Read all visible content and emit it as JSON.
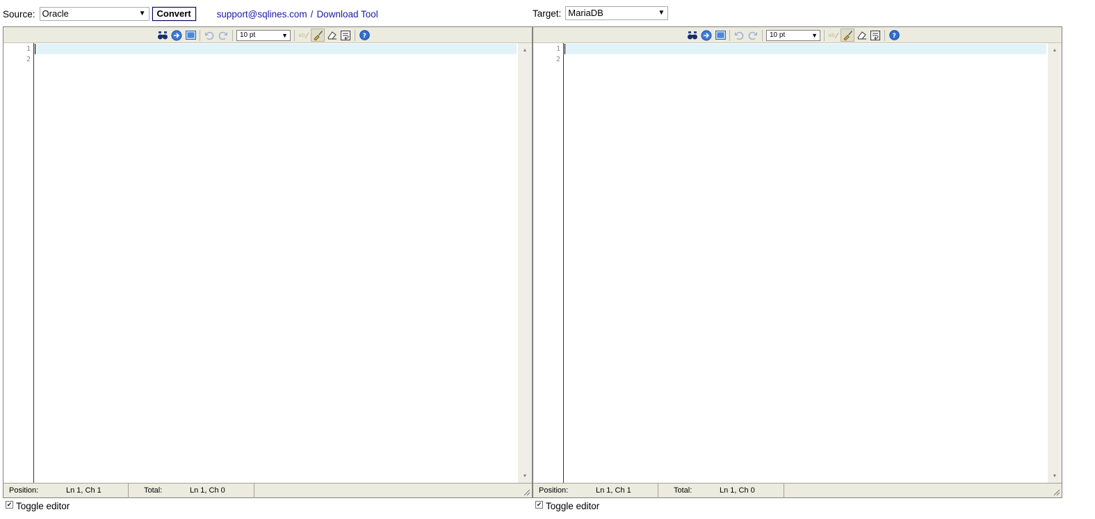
{
  "source": {
    "label": "Source:",
    "selected": "Oracle",
    "convert_label": "Convert",
    "support_link": "support@sqlines.com",
    "separator": "/",
    "download_link": "Download Tool"
  },
  "target": {
    "label": "Target:",
    "selected": "MariaDB"
  },
  "editors": {
    "left": {
      "font_size": "10 pt",
      "line_numbers": [
        "1",
        "2"
      ],
      "status": {
        "position_label": "Position:",
        "position_value": "Ln 1, Ch 1",
        "total_label": "Total:",
        "total_value": "Ln 1, Ch 0"
      },
      "toggle_label": "Toggle editor",
      "toggle_checked": "✔"
    },
    "right": {
      "font_size": "10 pt",
      "line_numbers": [
        "1",
        "2"
      ],
      "status": {
        "position_label": "Position:",
        "position_value": "Ln 1, Ch 1",
        "total_label": "Total:",
        "total_value": "Ln 1, Ch 0"
      },
      "toggle_label": "Toggle editor",
      "toggle_checked": "✔"
    }
  },
  "icons": {
    "arrow": "▼",
    "scroll_up": "▲",
    "scroll_down": "▼"
  },
  "colors": {
    "toolbar_bg": "#ecebdf",
    "active_line": "#e1f3f9",
    "link": "#1a1aa6"
  }
}
